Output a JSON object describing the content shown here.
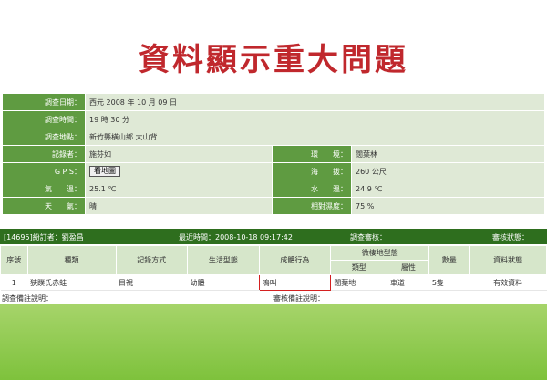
{
  "title": "資料顯示重大問題",
  "info": {
    "survey_date": {
      "label": "調查日期：",
      "value": "西元 2008 年 10 月 09 日"
    },
    "survey_time": {
      "label": "調查時間：",
      "value": "19 時 30 分"
    },
    "survey_place": {
      "label": "調查地點：",
      "value": "新竹縣橫山鄉 大山背"
    },
    "recorder": {
      "label": "記錄者：",
      "value": "施芬如"
    },
    "environment": {
      "label": "環　　境：",
      "value": "闊葉林"
    },
    "gps": {
      "label": "G P S：",
      "button": "看地圖"
    },
    "altitude": {
      "label": "海　　拔：",
      "value": "260 公尺"
    },
    "air_temp": {
      "label": "氣　　溫：",
      "value": "25.1 ℃"
    },
    "water_temp": {
      "label": "水　　溫：",
      "value": "24.9 ℃"
    },
    "weather": {
      "label": "天　　氣：",
      "value": "晴"
    },
    "humidity": {
      "label": "相對濕度：",
      "value": "75 %"
    }
  },
  "bar": {
    "subscriber": "[14695]紛訂者：劉盈昌",
    "recent_time": "最近時間：2008-10-18 09:17:42",
    "survey_review": "調查審核：",
    "review_status": "審核狀態："
  },
  "grid": {
    "headers": {
      "seq": "序號",
      "species": "種類",
      "method": "記錄方式",
      "stage": "生活型態",
      "group": "成體行為",
      "microhabitat": "微棲地型態",
      "type": "類型",
      "attr": "屬性",
      "count": "數量",
      "status": "資料狀態"
    },
    "rows": [
      {
        "seq": "1",
        "species": "狹蹼氏赤蛙",
        "method": "目視",
        "stage": "幼體",
        "group": "鳴叫",
        "type": "闊葉地",
        "attr": "車道",
        "count": "5隻",
        "status": "有效資料"
      }
    ]
  },
  "notes": {
    "survey_note": "調查備註說明：",
    "review_note": "審核備註說明："
  }
}
